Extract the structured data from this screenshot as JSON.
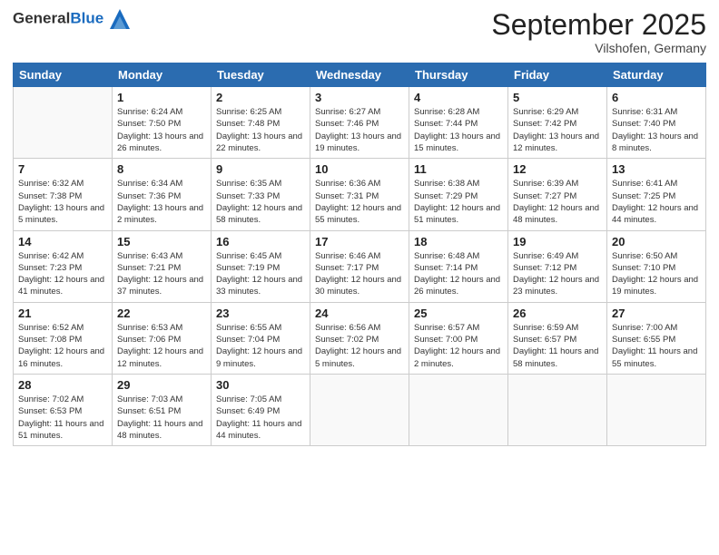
{
  "logo": {
    "text_general": "General",
    "text_blue": "Blue"
  },
  "header": {
    "month": "September 2025",
    "location": "Vilshofen, Germany"
  },
  "weekdays": [
    "Sunday",
    "Monday",
    "Tuesday",
    "Wednesday",
    "Thursday",
    "Friday",
    "Saturday"
  ],
  "weeks": [
    [
      {
        "day": "",
        "sunrise": "",
        "sunset": "",
        "daylight": ""
      },
      {
        "day": "1",
        "sunrise": "Sunrise: 6:24 AM",
        "sunset": "Sunset: 7:50 PM",
        "daylight": "Daylight: 13 hours and 26 minutes."
      },
      {
        "day": "2",
        "sunrise": "Sunrise: 6:25 AM",
        "sunset": "Sunset: 7:48 PM",
        "daylight": "Daylight: 13 hours and 22 minutes."
      },
      {
        "day": "3",
        "sunrise": "Sunrise: 6:27 AM",
        "sunset": "Sunset: 7:46 PM",
        "daylight": "Daylight: 13 hours and 19 minutes."
      },
      {
        "day": "4",
        "sunrise": "Sunrise: 6:28 AM",
        "sunset": "Sunset: 7:44 PM",
        "daylight": "Daylight: 13 hours and 15 minutes."
      },
      {
        "day": "5",
        "sunrise": "Sunrise: 6:29 AM",
        "sunset": "Sunset: 7:42 PM",
        "daylight": "Daylight: 13 hours and 12 minutes."
      },
      {
        "day": "6",
        "sunrise": "Sunrise: 6:31 AM",
        "sunset": "Sunset: 7:40 PM",
        "daylight": "Daylight: 13 hours and 8 minutes."
      }
    ],
    [
      {
        "day": "7",
        "sunrise": "Sunrise: 6:32 AM",
        "sunset": "Sunset: 7:38 PM",
        "daylight": "Daylight: 13 hours and 5 minutes."
      },
      {
        "day": "8",
        "sunrise": "Sunrise: 6:34 AM",
        "sunset": "Sunset: 7:36 PM",
        "daylight": "Daylight: 13 hours and 2 minutes."
      },
      {
        "day": "9",
        "sunrise": "Sunrise: 6:35 AM",
        "sunset": "Sunset: 7:33 PM",
        "daylight": "Daylight: 12 hours and 58 minutes."
      },
      {
        "day": "10",
        "sunrise": "Sunrise: 6:36 AM",
        "sunset": "Sunset: 7:31 PM",
        "daylight": "Daylight: 12 hours and 55 minutes."
      },
      {
        "day": "11",
        "sunrise": "Sunrise: 6:38 AM",
        "sunset": "Sunset: 7:29 PM",
        "daylight": "Daylight: 12 hours and 51 minutes."
      },
      {
        "day": "12",
        "sunrise": "Sunrise: 6:39 AM",
        "sunset": "Sunset: 7:27 PM",
        "daylight": "Daylight: 12 hours and 48 minutes."
      },
      {
        "day": "13",
        "sunrise": "Sunrise: 6:41 AM",
        "sunset": "Sunset: 7:25 PM",
        "daylight": "Daylight: 12 hours and 44 minutes."
      }
    ],
    [
      {
        "day": "14",
        "sunrise": "Sunrise: 6:42 AM",
        "sunset": "Sunset: 7:23 PM",
        "daylight": "Daylight: 12 hours and 41 minutes."
      },
      {
        "day": "15",
        "sunrise": "Sunrise: 6:43 AM",
        "sunset": "Sunset: 7:21 PM",
        "daylight": "Daylight: 12 hours and 37 minutes."
      },
      {
        "day": "16",
        "sunrise": "Sunrise: 6:45 AM",
        "sunset": "Sunset: 7:19 PM",
        "daylight": "Daylight: 12 hours and 33 minutes."
      },
      {
        "day": "17",
        "sunrise": "Sunrise: 6:46 AM",
        "sunset": "Sunset: 7:17 PM",
        "daylight": "Daylight: 12 hours and 30 minutes."
      },
      {
        "day": "18",
        "sunrise": "Sunrise: 6:48 AM",
        "sunset": "Sunset: 7:14 PM",
        "daylight": "Daylight: 12 hours and 26 minutes."
      },
      {
        "day": "19",
        "sunrise": "Sunrise: 6:49 AM",
        "sunset": "Sunset: 7:12 PM",
        "daylight": "Daylight: 12 hours and 23 minutes."
      },
      {
        "day": "20",
        "sunrise": "Sunrise: 6:50 AM",
        "sunset": "Sunset: 7:10 PM",
        "daylight": "Daylight: 12 hours and 19 minutes."
      }
    ],
    [
      {
        "day": "21",
        "sunrise": "Sunrise: 6:52 AM",
        "sunset": "Sunset: 7:08 PM",
        "daylight": "Daylight: 12 hours and 16 minutes."
      },
      {
        "day": "22",
        "sunrise": "Sunrise: 6:53 AM",
        "sunset": "Sunset: 7:06 PM",
        "daylight": "Daylight: 12 hours and 12 minutes."
      },
      {
        "day": "23",
        "sunrise": "Sunrise: 6:55 AM",
        "sunset": "Sunset: 7:04 PM",
        "daylight": "Daylight: 12 hours and 9 minutes."
      },
      {
        "day": "24",
        "sunrise": "Sunrise: 6:56 AM",
        "sunset": "Sunset: 7:02 PM",
        "daylight": "Daylight: 12 hours and 5 minutes."
      },
      {
        "day": "25",
        "sunrise": "Sunrise: 6:57 AM",
        "sunset": "Sunset: 7:00 PM",
        "daylight": "Daylight: 12 hours and 2 minutes."
      },
      {
        "day": "26",
        "sunrise": "Sunrise: 6:59 AM",
        "sunset": "Sunset: 6:57 PM",
        "daylight": "Daylight: 11 hours and 58 minutes."
      },
      {
        "day": "27",
        "sunrise": "Sunrise: 7:00 AM",
        "sunset": "Sunset: 6:55 PM",
        "daylight": "Daylight: 11 hours and 55 minutes."
      }
    ],
    [
      {
        "day": "28",
        "sunrise": "Sunrise: 7:02 AM",
        "sunset": "Sunset: 6:53 PM",
        "daylight": "Daylight: 11 hours and 51 minutes."
      },
      {
        "day": "29",
        "sunrise": "Sunrise: 7:03 AM",
        "sunset": "Sunset: 6:51 PM",
        "daylight": "Daylight: 11 hours and 48 minutes."
      },
      {
        "day": "30",
        "sunrise": "Sunrise: 7:05 AM",
        "sunset": "Sunset: 6:49 PM",
        "daylight": "Daylight: 11 hours and 44 minutes."
      },
      {
        "day": "",
        "sunrise": "",
        "sunset": "",
        "daylight": ""
      },
      {
        "day": "",
        "sunrise": "",
        "sunset": "",
        "daylight": ""
      },
      {
        "day": "",
        "sunrise": "",
        "sunset": "",
        "daylight": ""
      },
      {
        "day": "",
        "sunrise": "",
        "sunset": "",
        "daylight": ""
      }
    ]
  ]
}
